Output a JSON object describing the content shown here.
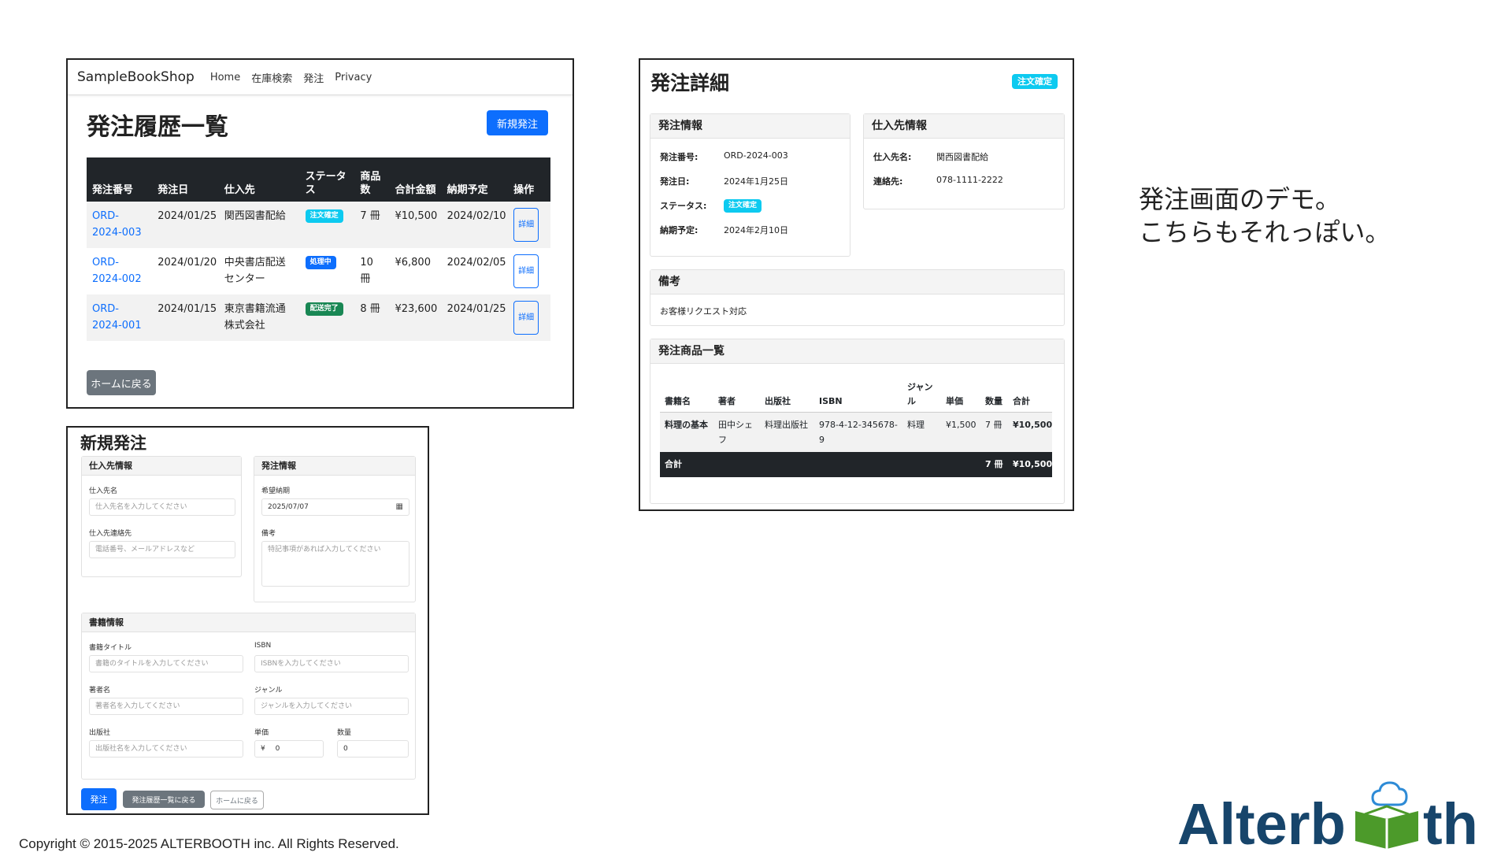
{
  "history": {
    "navbar": {
      "brand": "SampleBookShop",
      "links": [
        "Home",
        "在庫検索",
        "発注",
        "Privacy"
      ]
    },
    "title": "発注履歴一覧",
    "new_order_button": "新規発注",
    "columns": [
      "発注番号",
      "発注日",
      "仕入先",
      "ステータス",
      "商品数",
      "合計金額",
      "納期予定",
      "操作"
    ],
    "rows": [
      {
        "order_no": "ORD-2024-003",
        "order_date": "2024/01/25",
        "supplier": "関西図書配給",
        "status": "注文確定",
        "status_color": "#0dcaf0",
        "items": "7 冊",
        "total": "¥10,500",
        "due": "2024/02/10",
        "action": "詳細"
      },
      {
        "order_no": "ORD-2024-002",
        "order_date": "2024/01/20",
        "supplier": "中央書店配送センター",
        "status": "処理中",
        "status_color": "#0d6efd",
        "items": "10 冊",
        "total": "¥6,800",
        "due": "2024/02/05",
        "action": "詳細"
      },
      {
        "order_no": "ORD-2024-001",
        "order_date": "2024/01/15",
        "supplier": "東京書籍流通株式会社",
        "status": "配送完了",
        "status_color": "#198754",
        "items": "8 冊",
        "total": "¥23,600",
        "due": "2024/01/25",
        "action": "詳細"
      }
    ],
    "home_button": "ホームに戻る"
  },
  "new_order": {
    "title": "新規発注",
    "supplier_card": {
      "header": "仕入先情報",
      "name_label": "仕入先名",
      "name_placeholder": "仕入先名を入力してください",
      "contact_label": "仕入先連絡先",
      "contact_placeholder": "電話番号、メールアドレスなど"
    },
    "order_card": {
      "header": "発注情報",
      "date_label": "希望納期",
      "date_value": "2025/07/07",
      "notes_label": "備考",
      "notes_placeholder": "特記事項があれば入力してください"
    },
    "book_card": {
      "header": "書籍情報",
      "title_label": "書籍タイトル",
      "title_placeholder": "書籍のタイトルを入力してください",
      "isbn_label": "ISBN",
      "isbn_placeholder": "ISBNを入力してください",
      "author_label": "著者名",
      "author_placeholder": "著者名を入力してください",
      "genre_label": "ジャンル",
      "genre_placeholder": "ジャンルを入力してください",
      "publisher_label": "出版社",
      "publisher_placeholder": "出版社名を入力してください",
      "price_label": "単価",
      "price_prefix": "¥",
      "price_value": "0",
      "qty_label": "数量",
      "qty_value": "0"
    },
    "buttons": {
      "submit": "発注",
      "back_to_list": "発注履歴一覧に戻る",
      "home": "ホームに戻る"
    }
  },
  "detail": {
    "title": "発注詳細",
    "status_badge": "注文確定",
    "order_info": {
      "header": "発注情報",
      "order_no_label": "発注番号:",
      "order_no": "ORD-2024-003",
      "date_label": "発注日:",
      "date": "2024年1月25日",
      "status_label": "ステータス:",
      "status": "注文確定",
      "due_label": "納期予定:",
      "due": "2024年2月10日"
    },
    "supplier_info": {
      "header": "仕入先情報",
      "name_label": "仕入先名:",
      "name": "関西図書配給",
      "contact_label": "連絡先:",
      "contact": "078-1111-2222"
    },
    "notes": {
      "header": "備考",
      "text": "お客様リクエスト対応"
    },
    "items": {
      "header": "発注商品一覧",
      "columns": [
        "書籍名",
        "著者",
        "出版社",
        "ISBN",
        "ジャンル",
        "単価",
        "数量",
        "合計"
      ],
      "rows": [
        {
          "title": "料理の基本",
          "author": "田中シェフ",
          "publisher": "料理出版社",
          "isbn": "978-4-12-345678-9",
          "genre": "料理",
          "price": "¥1,500",
          "qty": "7 冊",
          "total": "¥10,500"
        }
      ],
      "total_label": "合計",
      "total_qty": "7 冊",
      "total_amount": "¥10,500"
    }
  },
  "caption": {
    "line1": "発注画面のデモ。",
    "line2": "こちらもそれっぽい。"
  },
  "footer": {
    "copyright": "Copyright © 2015-2025 ALTERBOOTH inc. All Rights Reserved."
  },
  "logo": {
    "text_left": "Alterb",
    "text_right": "th",
    "color_text": "#17456b",
    "color_green": "#4c9a2a",
    "color_cloud": "#2e8bd6"
  }
}
